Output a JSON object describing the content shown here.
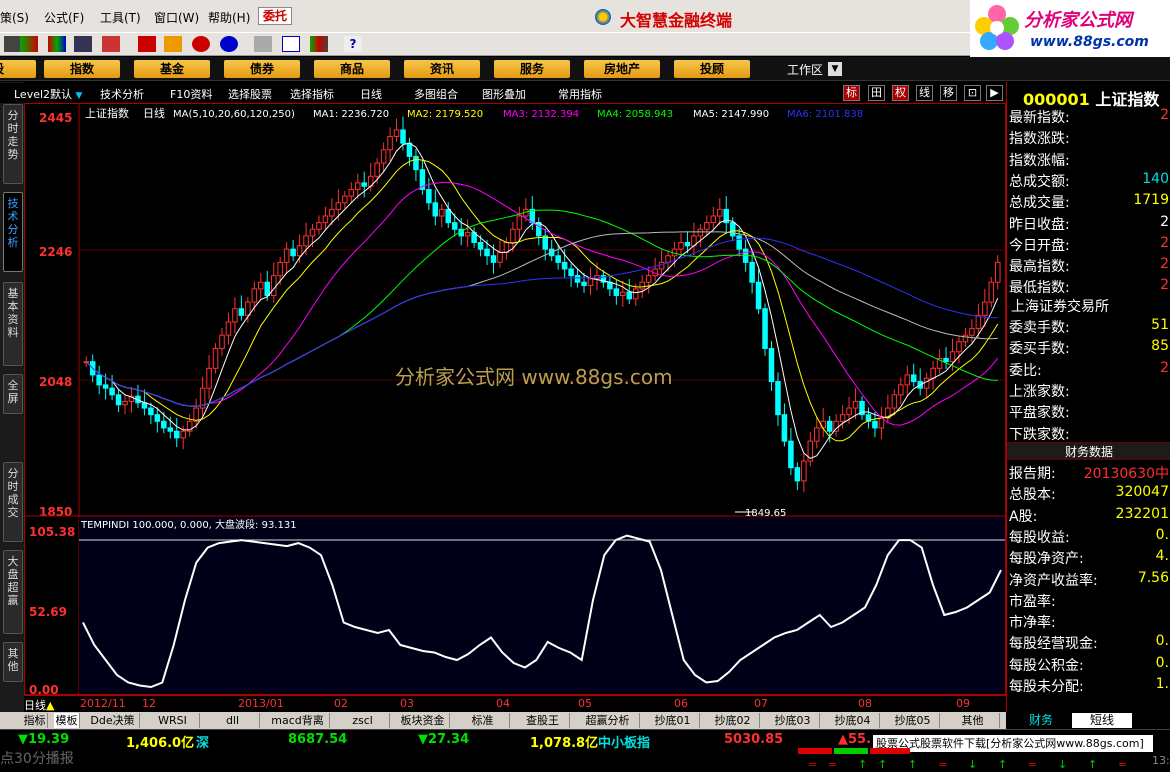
{
  "menu": {
    "items": [
      "策(S)",
      "公式(F)",
      "工具(T)",
      "窗口(W)",
      "帮助(H)"
    ],
    "weituo": "委托",
    "brand": "大智慧金融终端"
  },
  "logo": {
    "title": "分析家公式网",
    "url": "www.88gs.com"
  },
  "categories": [
    "股",
    "指数",
    "基金",
    "债券",
    "商品",
    "资讯",
    "服务",
    "房地产",
    "投顾"
  ],
  "workspace": "工作区",
  "left_tabs": [
    "分时走势",
    "技术分析",
    "基本资料",
    "全屏",
    "分时成交",
    "大盘超赢",
    "其他"
  ],
  "subbar": {
    "items": [
      "Level2默认",
      "技术分析",
      "F10资料",
      "选择股票",
      "选择指标",
      "日线",
      "多图组合",
      "图形叠加",
      "常用指标"
    ],
    "right_buttons": [
      "标",
      "田",
      "权",
      "线",
      "移",
      "",
      ""
    ]
  },
  "chart": {
    "title": "上证指数",
    "period": "日线",
    "ma_label": "MA(5,10,20,60,120,250)",
    "ma_values": [
      {
        "label": "MA1: 2236.720",
        "color": "#ffffff"
      },
      {
        "label": "MA2: 2179.520",
        "color": "#ffff00"
      },
      {
        "label": "MA3: 2132.394",
        "color": "#ff00ff"
      },
      {
        "label": "MA4: 2058.943",
        "color": "#00ff00"
      },
      {
        "label": "MA5: 2147.990",
        "color": "#ffffff"
      },
      {
        "label": "MA6: 2101.838",
        "color": "#3030ff"
      }
    ],
    "y_ticks": [
      "2445",
      "2246",
      "2048",
      "1850"
    ],
    "low_annotation": "1849.65",
    "watermark": "分析家公式网 www.88gs.com",
    "indicator_label": "TEMPINDI 100.000, 0.000, 大盘波段: 93.131",
    "indicator_ticks": [
      "105.38",
      "52.69",
      "0.00"
    ],
    "x_labels": [
      "2012/11",
      "12",
      "2013/01",
      "02",
      "03",
      "04",
      "05",
      "06",
      "07",
      "08",
      "09"
    ],
    "bottom_left_label": "日线"
  },
  "chart_data": {
    "type": "candlestick",
    "title": "上证指数",
    "ylim": [
      1850,
      2445
    ],
    "close": [
      2080,
      2060,
      2045,
      2040,
      2030,
      2015,
      2020,
      2028,
      2018,
      2010,
      2000,
      1990,
      1980,
      1975,
      1965,
      1975,
      1990,
      2010,
      2040,
      2070,
      2100,
      2120,
      2140,
      2160,
      2150,
      2170,
      2190,
      2200,
      2180,
      2210,
      2230,
      2250,
      2240,
      2255,
      2270,
      2280,
      2290,
      2300,
      2310,
      2320,
      2330,
      2340,
      2350,
      2345,
      2360,
      2380,
      2400,
      2420,
      2430,
      2410,
      2390,
      2370,
      2340,
      2320,
      2300,
      2310,
      2290,
      2280,
      2270,
      2275,
      2260,
      2250,
      2240,
      2230,
      2245,
      2260,
      2280,
      2300,
      2310,
      2290,
      2270,
      2250,
      2240,
      2230,
      2220,
      2210,
      2200,
      2195,
      2205,
      2210,
      2200,
      2190,
      2180,
      2185,
      2175,
      2190,
      2200,
      2210,
      2220,
      2230,
      2240,
      2250,
      2260,
      2255,
      2270,
      2280,
      2290,
      2300,
      2310,
      2290,
      2270,
      2250,
      2230,
      2200,
      2160,
      2100,
      2050,
      2000,
      1960,
      1920,
      1900,
      1930,
      1960,
      1980,
      1990,
      1975,
      1990,
      2000,
      2010,
      2020,
      2000,
      1990,
      1980,
      1995,
      2010,
      2030,
      2045,
      2060,
      2050,
      2040,
      2055,
      2070,
      2085,
      2080,
      2095,
      2110,
      2120,
      2130,
      2150,
      2170,
      2200,
      2230
    ],
    "indicator": [
      45,
      30,
      20,
      10,
      5,
      3,
      2,
      5,
      30,
      60,
      85,
      95,
      98,
      99,
      100,
      99,
      98,
      97,
      96,
      98,
      95,
      90,
      70,
      45,
      42,
      40,
      38,
      40,
      30,
      28,
      26,
      25,
      22,
      20,
      24,
      30,
      35,
      25,
      18,
      15,
      20,
      32,
      28,
      25,
      20,
      60,
      90,
      100,
      103,
      101,
      99,
      80,
      50,
      20,
      10,
      5,
      6,
      12,
      20,
      25,
      30,
      35,
      38,
      40,
      45,
      50,
      42,
      45,
      50,
      55,
      70,
      90,
      100,
      100,
      95,
      70,
      50,
      52,
      55,
      60,
      65,
      80
    ]
  },
  "right_panel": {
    "code": "000001",
    "name": "上证指数",
    "rows": [
      {
        "label": "最新指数:",
        "value": "2",
        "color": "#ff3030"
      },
      {
        "label": "指数涨跌:",
        "value": "",
        "color": "#ff3030"
      },
      {
        "label": "指数涨幅:",
        "value": "",
        "color": "#ff3030"
      },
      {
        "label": "总成交额:",
        "value": "140",
        "color": "#00e0e0"
      },
      {
        "label": "总成交量:",
        "value": "1719",
        "color": "#ffff00"
      },
      {
        "label": "昨日收盘:",
        "value": "2",
        "color": "#ffffff"
      },
      {
        "label": "今日开盘:",
        "value": "2",
        "color": "#ff3030"
      },
      {
        "label": "最高指数:",
        "value": "2",
        "color": "#ff3030"
      },
      {
        "label": "最低指数:",
        "value": "2",
        "color": "#ff3030"
      }
    ],
    "exchange": "上海证券交易所",
    "rows2": [
      {
        "label": "委卖手数:",
        "value": "51",
        "color": "#ffff00"
      },
      {
        "label": "委买手数:",
        "value": "85",
        "color": "#ffff00"
      },
      {
        "label": "委比:",
        "value": "2",
        "color": "#ff3030"
      },
      {
        "label": "上涨家数:",
        "value": "",
        "color": "#ff3030"
      },
      {
        "label": "平盘家数:",
        "value": "",
        "color": "#ffffff"
      },
      {
        "label": "下跌家数:",
        "value": "",
        "color": "#00e000"
      }
    ],
    "fin_header": "财务数据",
    "fin_rows": [
      {
        "label": "报告期:",
        "value": "20130630中",
        "color": "#ff3030"
      },
      {
        "label": "总股本:",
        "value": "320047",
        "color": "#ffff00"
      },
      {
        "label": "A股:",
        "value": "232201",
        "color": "#ffff00"
      },
      {
        "label": "每股收益:",
        "value": "0.",
        "color": "#ffff00"
      },
      {
        "label": "每股净资产:",
        "value": "4.",
        "color": "#ffff00"
      },
      {
        "label": "净资产收益率:",
        "value": "7.56",
        "color": "#ffff00"
      },
      {
        "label": "市盈率:",
        "value": "",
        "color": "#ffff00"
      },
      {
        "label": "市净率:",
        "value": "",
        "color": "#ffff00"
      },
      {
        "label": "每股经营现金:",
        "value": "0.",
        "color": "#ffff00"
      },
      {
        "label": "每股公积金:",
        "value": "0.",
        "color": "#ffff00"
      },
      {
        "label": "每股未分配:",
        "value": "1.",
        "color": "#ffff00"
      }
    ]
  },
  "bottom_tabs": [
    "指标",
    "模板",
    "Dde决策",
    "WRSI",
    "dll",
    "macd背离",
    "zscl",
    "板块资金",
    "标准",
    "查股王",
    "超赢分析",
    "抄底01",
    "抄底02",
    "抄底03",
    "抄底04",
    "抄底05",
    "其他"
  ],
  "right_tabs": [
    "财务",
    "短线"
  ],
  "status": {
    "s1": "▼19.39",
    "s2": "1,406.0亿",
    "s2b": "深",
    "s3": "8687.54",
    "s4": "▼27.34",
    "s5": "1,078.8亿",
    "s5b": "中小板指",
    "s6": "5030.85",
    "s7": "▲55.",
    "ticker": "点30分播报",
    "promo": "股票公式股票软件下载[分析家公式网www.88gs.com]",
    "clock": "13:"
  }
}
